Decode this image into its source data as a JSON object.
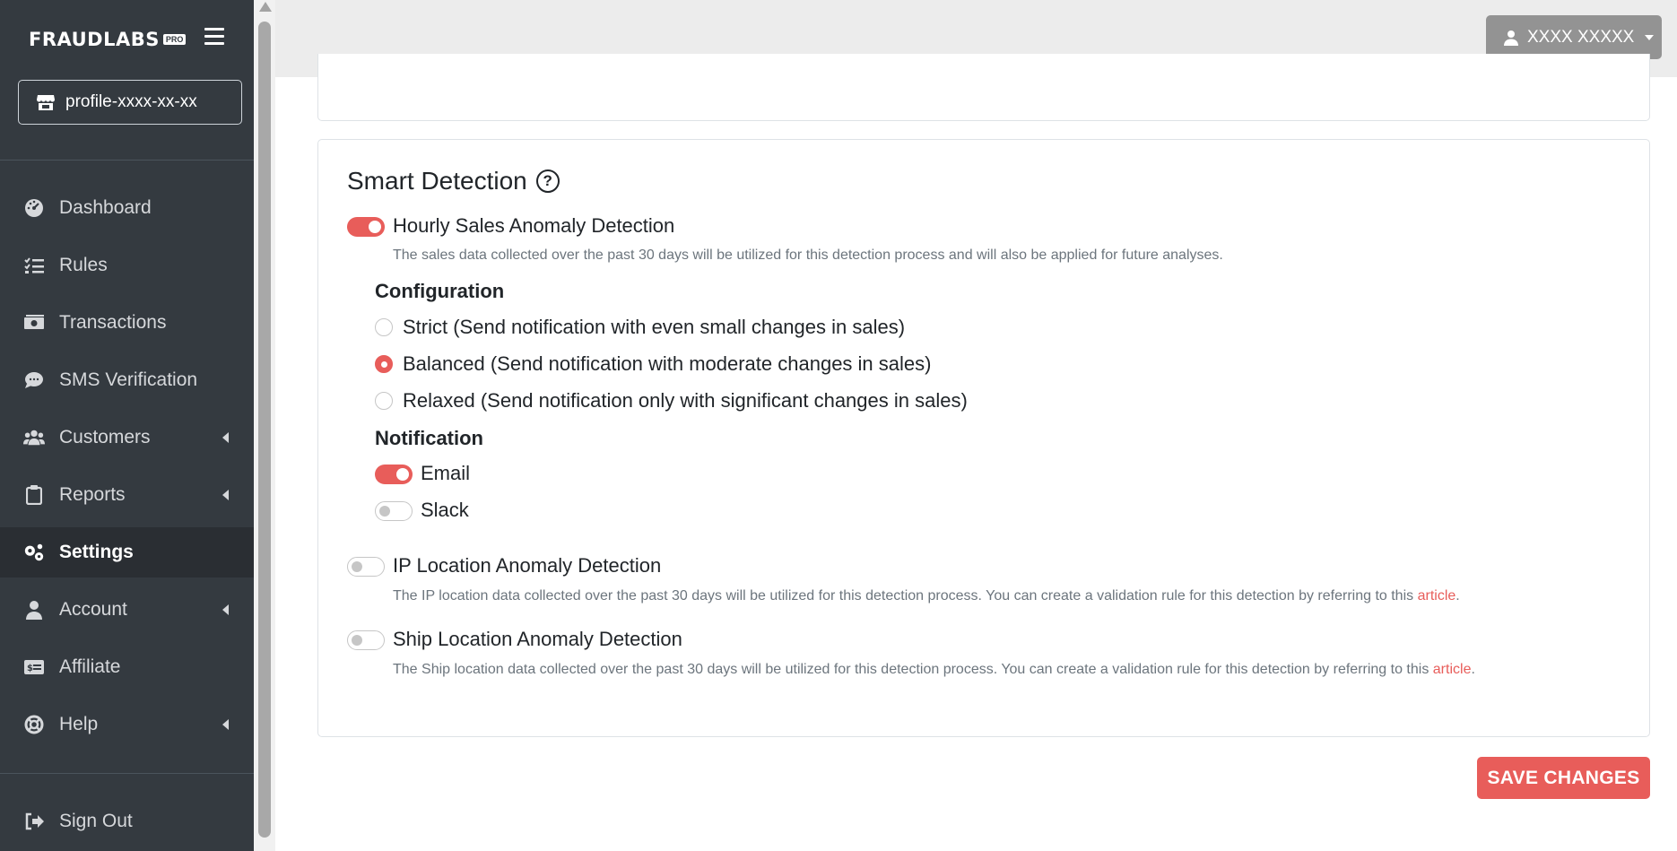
{
  "brand": {
    "name": "FRAUDLABS",
    "badge": "PRO"
  },
  "profile": {
    "label": "profile-xxxx-xx-xx"
  },
  "sidebar": {
    "items": [
      {
        "label": "Dashboard",
        "icon": "dashboard-icon"
      },
      {
        "label": "Rules",
        "icon": "rules-list-icon"
      },
      {
        "label": "Transactions",
        "icon": "money-bill-icon"
      },
      {
        "label": "SMS Verification",
        "icon": "sms-icon"
      },
      {
        "label": "Customers",
        "icon": "users-icon"
      },
      {
        "label": "Reports",
        "icon": "clipboard-icon"
      },
      {
        "label": "Settings",
        "icon": "gears-icon"
      },
      {
        "label": "Account",
        "icon": "user-icon"
      },
      {
        "label": "Affiliate",
        "icon": "affiliate-card-icon"
      },
      {
        "label": "Help",
        "icon": "life-ring-icon"
      }
    ],
    "sign_out": "Sign Out"
  },
  "topbar": {
    "user_name": "XXXX XXXXX"
  },
  "smart_detection": {
    "title": "Smart Detection",
    "help_glyph": "?",
    "hourly": {
      "label": "Hourly Sales Anomaly Detection",
      "enabled": true,
      "description": "The sales data collected over the past 30 days will be utilized for this detection process and will also be applied for future analyses."
    },
    "configuration": {
      "heading": "Configuration",
      "options": [
        {
          "label": "Strict (Send notification with even small changes in sales)",
          "checked": false
        },
        {
          "label": "Balanced (Send notification with moderate changes in sales)",
          "checked": true
        },
        {
          "label": "Relaxed (Send notification only with significant changes in sales)",
          "checked": false
        }
      ]
    },
    "notification": {
      "heading": "Notification",
      "email": {
        "label": "Email",
        "enabled": true
      },
      "slack": {
        "label": "Slack",
        "enabled": false
      }
    },
    "ip_location": {
      "label": "IP Location Anomaly Detection",
      "enabled": false,
      "description": "The IP location data collected over the past 30 days will be utilized for this detection process. You can create a validation rule for this detection by referring to this",
      "link": "article"
    },
    "ship_location": {
      "label": "Ship Location Anomaly Detection",
      "enabled": false,
      "description": "The Ship location data collected over the past 30 days will be utilized for this detection process. You can create a validation rule for this detection by referring to this",
      "link": "article"
    }
  },
  "actions": {
    "save_label": "SAVE CHANGES"
  },
  "colors": {
    "accent": "#e85d5a",
    "sidebar_bg": "#343a40",
    "topbar_bg": "#ececec"
  }
}
